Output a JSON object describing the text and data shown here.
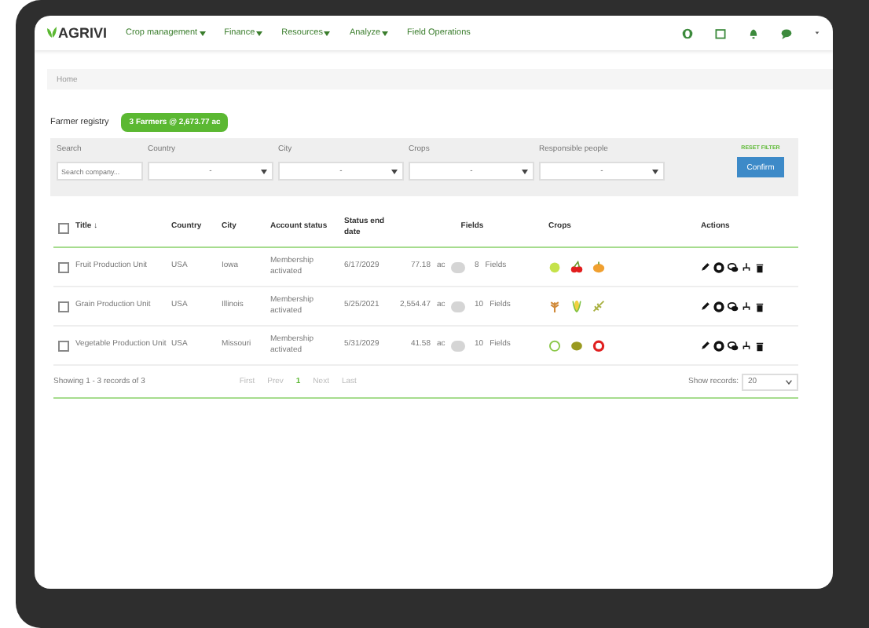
{
  "header": {
    "logo": "AGRIVI",
    "nav": [
      {
        "label": "Crop management",
        "dropdown": true
      },
      {
        "label": "Finance",
        "dropdown": true
      },
      {
        "label": "Resources",
        "dropdown": true
      },
      {
        "label": "Analyze",
        "dropdown": true
      },
      {
        "label": "Field Operations",
        "dropdown": false
      }
    ]
  },
  "breadcrumb": "Home",
  "page": {
    "title": "Farmer registry",
    "summary": "3 Farmers @ 2,673.77 ac"
  },
  "filters": {
    "search": {
      "label": "Search",
      "placeholder": "Search company..."
    },
    "selects": [
      {
        "label": "Country",
        "value": "-"
      },
      {
        "label": "City",
        "value": "-"
      },
      {
        "label": "Crops",
        "value": "-"
      },
      {
        "label": "Responsible people",
        "value": "-"
      }
    ],
    "reset": "RESET FILTER",
    "confirm": "Confirm"
  },
  "table": {
    "select_all": {
      "checked": false
    },
    "columns": [
      "Title ↓",
      "Country",
      "City",
      "Account status",
      "Status end date",
      "Fields",
      "Crops",
      "Actions"
    ],
    "rows": [
      {
        "checked": false,
        "title": "Fruit Production Unit",
        "country": "USA",
        "city": "Iowa",
        "status": "Membership activated",
        "end_date": "6/17/2029",
        "area": "77.18",
        "unit": "ac",
        "fields": "8",
        "fields_label": "Fields",
        "crops": [
          {
            "kind": "apple"
          },
          {
            "kind": "cherry"
          },
          {
            "kind": "pumpkin"
          }
        ]
      },
      {
        "checked": false,
        "title": "Grain Production Unit",
        "country": "USA",
        "city": "Illinois",
        "status": "Membership activated",
        "end_date": "5/25/2021",
        "area": "2,554.47",
        "unit": "ac",
        "fields": "10",
        "fields_label": "Fields",
        "crops": [
          {
            "kind": "wheat"
          },
          {
            "kind": "corn"
          },
          {
            "kind": "barley"
          }
        ]
      },
      {
        "checked": false,
        "title": "Vegetable Production Unit",
        "country": "USA",
        "city": "Missouri",
        "status": "Membership activated",
        "end_date": "5/31/2029",
        "area": "41.58",
        "unit": "ac",
        "fields": "10",
        "fields_label": "Fields",
        "crops": [
          {
            "kind": "cabbage"
          },
          {
            "kind": "potato"
          },
          {
            "kind": "tomato"
          }
        ]
      }
    ]
  },
  "footer": {
    "showing": "Showing 1 - 3 records of 3",
    "pages": [
      {
        "label": "First",
        "selected": false
      },
      {
        "label": "Prev",
        "selected": false
      },
      {
        "label": "1",
        "selected": true
      },
      {
        "label": "Next",
        "selected": false
      },
      {
        "label": "Last",
        "selected": false
      }
    ],
    "show_records_label": "Show records:",
    "show_records": "20"
  }
}
